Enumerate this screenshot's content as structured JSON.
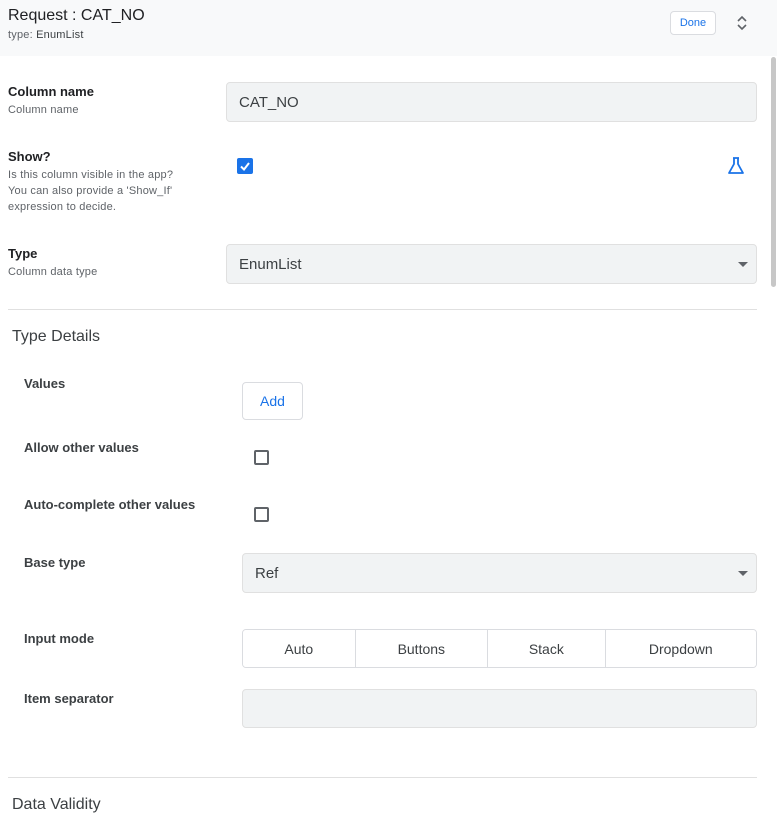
{
  "header": {
    "title": "Request : CAT_NO",
    "type_prefix": "type:",
    "type_value": "EnumList",
    "done_label": "Done",
    "collapse_icon": "collapse-icon"
  },
  "column_name": {
    "label": "Column name",
    "desc": "Column name",
    "value": "CAT_NO"
  },
  "show": {
    "label": "Show?",
    "desc_line1": "Is this column visible in the app?",
    "desc_line2": "You can also provide a 'Show_If'",
    "desc_line3": "expression to decide.",
    "checked": true,
    "expression_icon": "flask-icon"
  },
  "type": {
    "label": "Type",
    "desc": "Column data type",
    "value": "EnumList"
  },
  "type_details": {
    "title": "Type Details",
    "values_label": "Values",
    "add_label": "Add",
    "allow_other_label": "Allow other values",
    "allow_other_checked": false,
    "autocomplete_label": "Auto-complete other values",
    "autocomplete_checked": false,
    "base_type_label": "Base type",
    "base_type_value": "Ref",
    "input_mode_label": "Input mode",
    "input_mode_options": [
      "Auto",
      "Buttons",
      "Stack",
      "Dropdown"
    ],
    "item_separator_label": "Item separator",
    "item_separator_value": ""
  },
  "data_validity": {
    "title": "Data Validity"
  },
  "colors": {
    "accent": "#1a73e8",
    "header_bg": "#f8f9fa",
    "input_bg": "#f1f3f4"
  }
}
